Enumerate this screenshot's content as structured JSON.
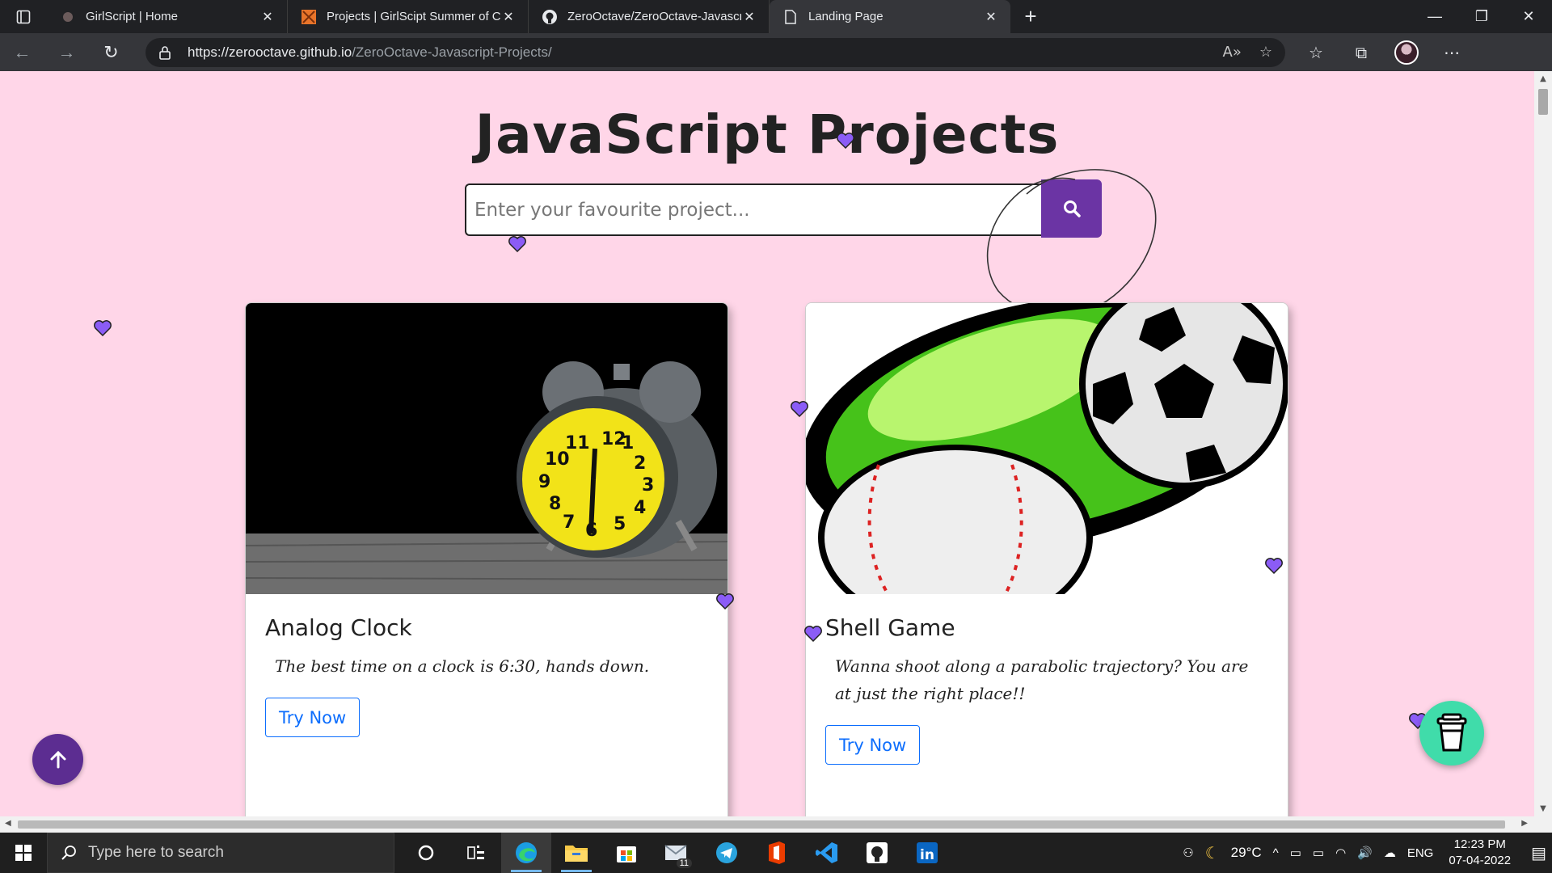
{
  "browser": {
    "tabs": [
      {
        "title": "GirlScript | Home",
        "active": false
      },
      {
        "title": "Projects | GirlScipt Summer of Code",
        "active": false
      },
      {
        "title": "ZeroOctave/ZeroOctave-Javascript-Projects",
        "active": false
      },
      {
        "title": "Landing Page",
        "active": true
      }
    ],
    "new_tab_label": "+",
    "url_host": "https://zerooctave.github.io",
    "url_path": "/ZeroOctave-Javascript-Projects/"
  },
  "page": {
    "title": "JavaScript Projects",
    "search": {
      "placeholder": "Enter your favourite project..."
    },
    "cards": [
      {
        "title": "Analog Clock",
        "text": "The best time on a clock is 6:30, hands down.",
        "button": "Try Now",
        "image": "alarm-clock-image",
        "clock_numbers": [
          "12",
          "1",
          "2",
          "3",
          "4",
          "5",
          "6",
          "7",
          "8",
          "9",
          "10",
          "11"
        ]
      },
      {
        "title": "Shell Game",
        "text": "Wanna shoot along a parabolic trajectory? You are at just the right place!!",
        "button": "Try Now",
        "image": "soccer-baseball-image"
      }
    ],
    "accent": "#6b34a4",
    "background": "#ffd6e8"
  },
  "taskbar": {
    "search_placeholder": "Type here to search",
    "mail_badge": "11",
    "weather": "29°C",
    "language": "ENG",
    "time": "12:23 PM",
    "date": "07-04-2022"
  }
}
